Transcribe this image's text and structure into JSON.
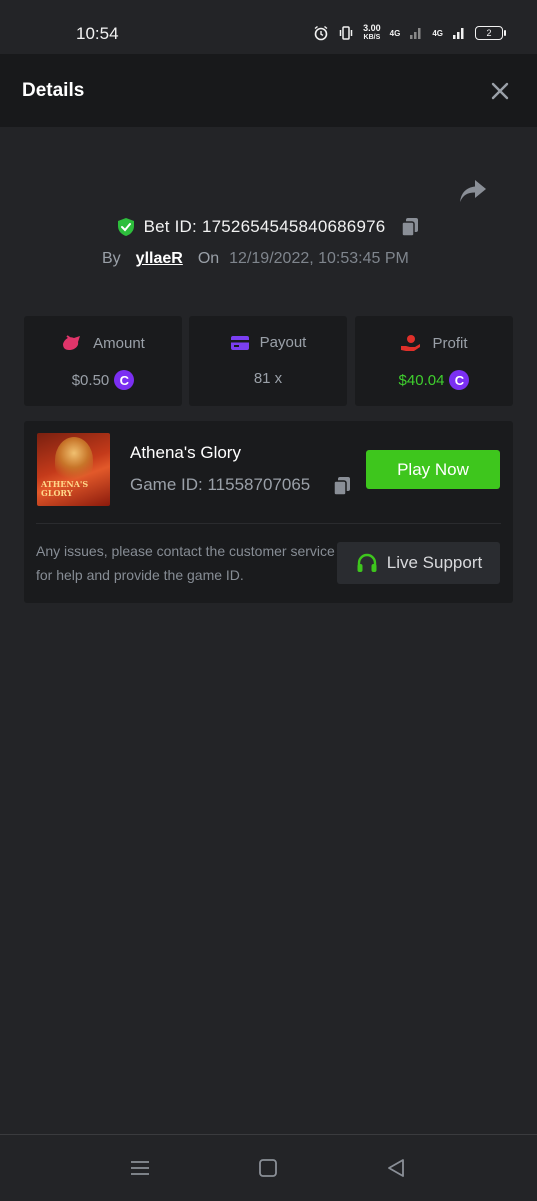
{
  "status_bar": {
    "time": "10:54",
    "speed_value": "3.00",
    "speed_unit": "KB/S",
    "net1": "4G",
    "net2": "4G",
    "battery": "2"
  },
  "header": {
    "title": "Details"
  },
  "bet": {
    "label": "Bet ID:",
    "id": "1752654545840686976",
    "by_label": "By",
    "user": "yllaeR",
    "on_label": "On",
    "date": "12/19/2022, 10:53:45 PM"
  },
  "stats": {
    "amount_label": "Amount",
    "amount_value": "$0.50",
    "payout_label": "Payout",
    "payout_value": "81 x",
    "profit_label": "Profit",
    "profit_value": "$40.04",
    "coin_symbol": "C"
  },
  "game": {
    "name": "Athena's Glory",
    "id_label": "Game ID:",
    "id": "11558707065",
    "thumb_text_line1": "ATHENA'S",
    "thumb_text_line2": "GLORY",
    "play_label": "Play Now",
    "help_text": "Any issues, please contact the customer service for help and provide the game ID.",
    "support_label": "Live Support"
  },
  "colors": {
    "accent_green": "#3ec61d",
    "profit_green": "#3fcf2e",
    "coin_purple": "#7b2ff2"
  }
}
